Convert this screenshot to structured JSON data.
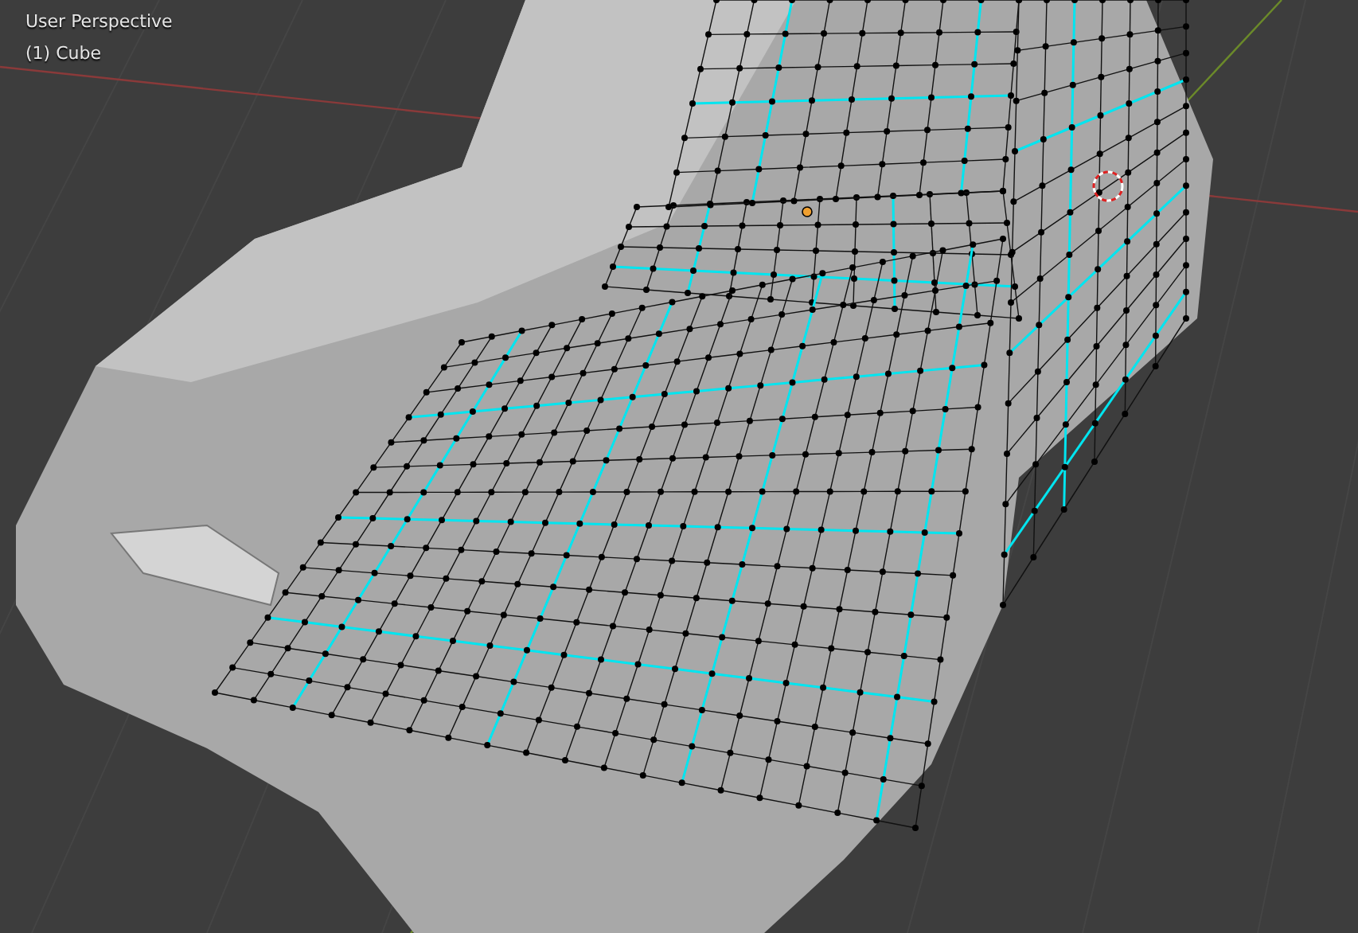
{
  "viewport": {
    "view_name": "User Perspective",
    "object_label": "(1) Cube"
  }
}
